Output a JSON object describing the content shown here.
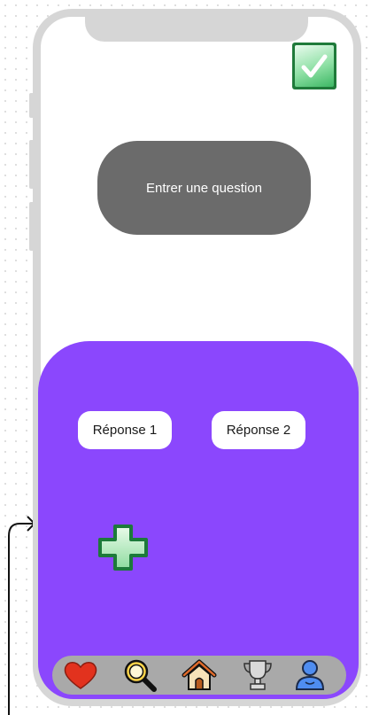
{
  "question": {
    "placeholder": "Entrer une question"
  },
  "answers": [
    {
      "label": "Réponse 1"
    },
    {
      "label": "Réponse 2"
    }
  ],
  "icons": {
    "confirm": "checkmark-icon",
    "add": "plus-icon",
    "tabs": [
      "heart-icon",
      "search-icon",
      "home-icon",
      "trophy-icon",
      "profile-icon"
    ]
  },
  "colors": {
    "answer_panel": "#8b47fd",
    "question_box": "#6b6b6b",
    "tab_bar": "#a9a9a9",
    "phone_frame": "#d6d6d6",
    "confirm_green": "#3db764"
  }
}
